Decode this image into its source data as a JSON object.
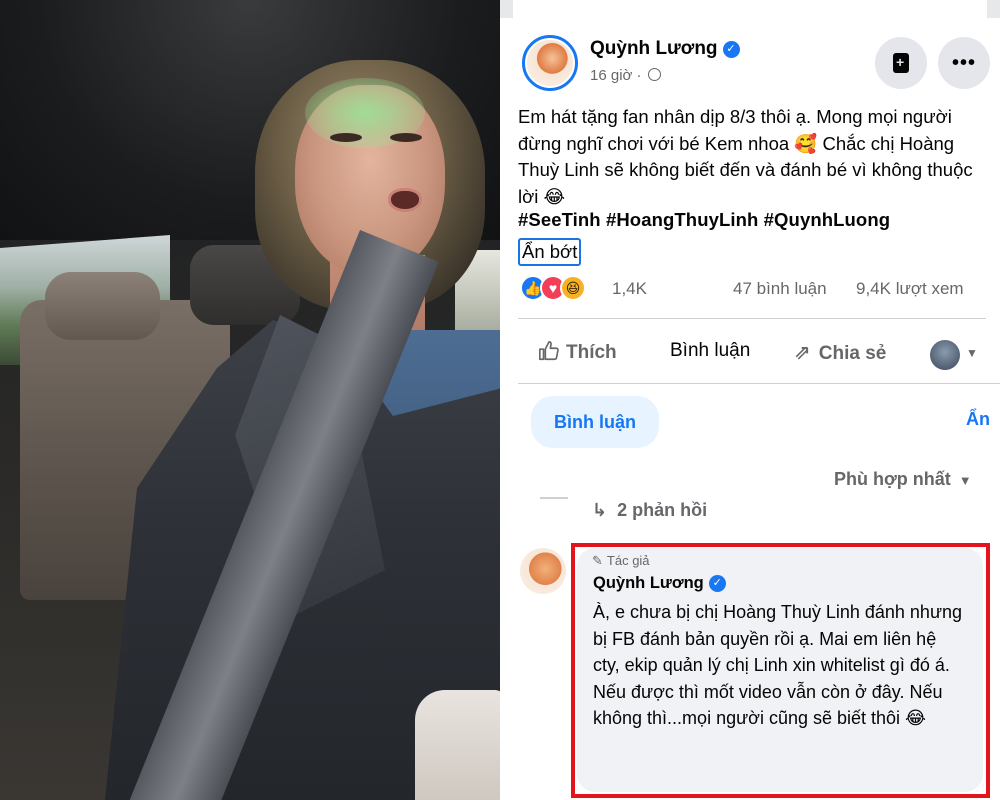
{
  "video": {
    "description_label": "video-frame"
  },
  "post": {
    "author": "Quỳnh Lương",
    "time": "16 giờ",
    "separator": "·",
    "save_icon": "bookmark-icon",
    "more_label": "•••",
    "body": "Em hát tặng fan nhân dịp 8/3 thôi ạ. Mong mọi người đừng nghĩ chơi với bé Kem nhoa 🥰 Chắc chị Hoàng Thuỳ Linh sẽ không biết đến và đánh bé vì không thuộc lời 😂",
    "hashtags": "#SeeTinh #HoangThuyLinh #QuynhLuong",
    "see_less": "Ẩn bớt",
    "reactions": {
      "icons": [
        "like-icon",
        "love-icon",
        "haha-icon"
      ],
      "like_glyph": "👍",
      "love_glyph": "♥",
      "haha_glyph": "😆",
      "count": "1,4K"
    },
    "comment_count": "47 bình luận",
    "view_count": "9,4K lượt xem",
    "actions": {
      "like": "Thích",
      "comment": "Bình luận",
      "share": "Chia sẻ"
    },
    "comments_tab": "Bình luận",
    "hide": "Ẩn",
    "sort": "Phù hợp nhất",
    "replies": "2 phản hồi",
    "reply_comment": {
      "tag": "Tác giả",
      "author": "Quỳnh Lương",
      "text": "À, e chưa bị chị Hoàng Thuỳ Linh đánh nhưng bị FB đánh bản quyền rồi ạ. Mai em liên hệ cty, ekip quản lý chị Linh xin whitelist gì đó á. Nếu được thì mốt video vẫn còn ở đây. Nếu không thì...mọi người cũng sẽ biết thôi 😂"
    }
  },
  "colors": {
    "accent": "#1877f2",
    "highlight_border": "#e3141b",
    "bubble": "#f0f2f5",
    "secondary_text": "#65676b"
  }
}
